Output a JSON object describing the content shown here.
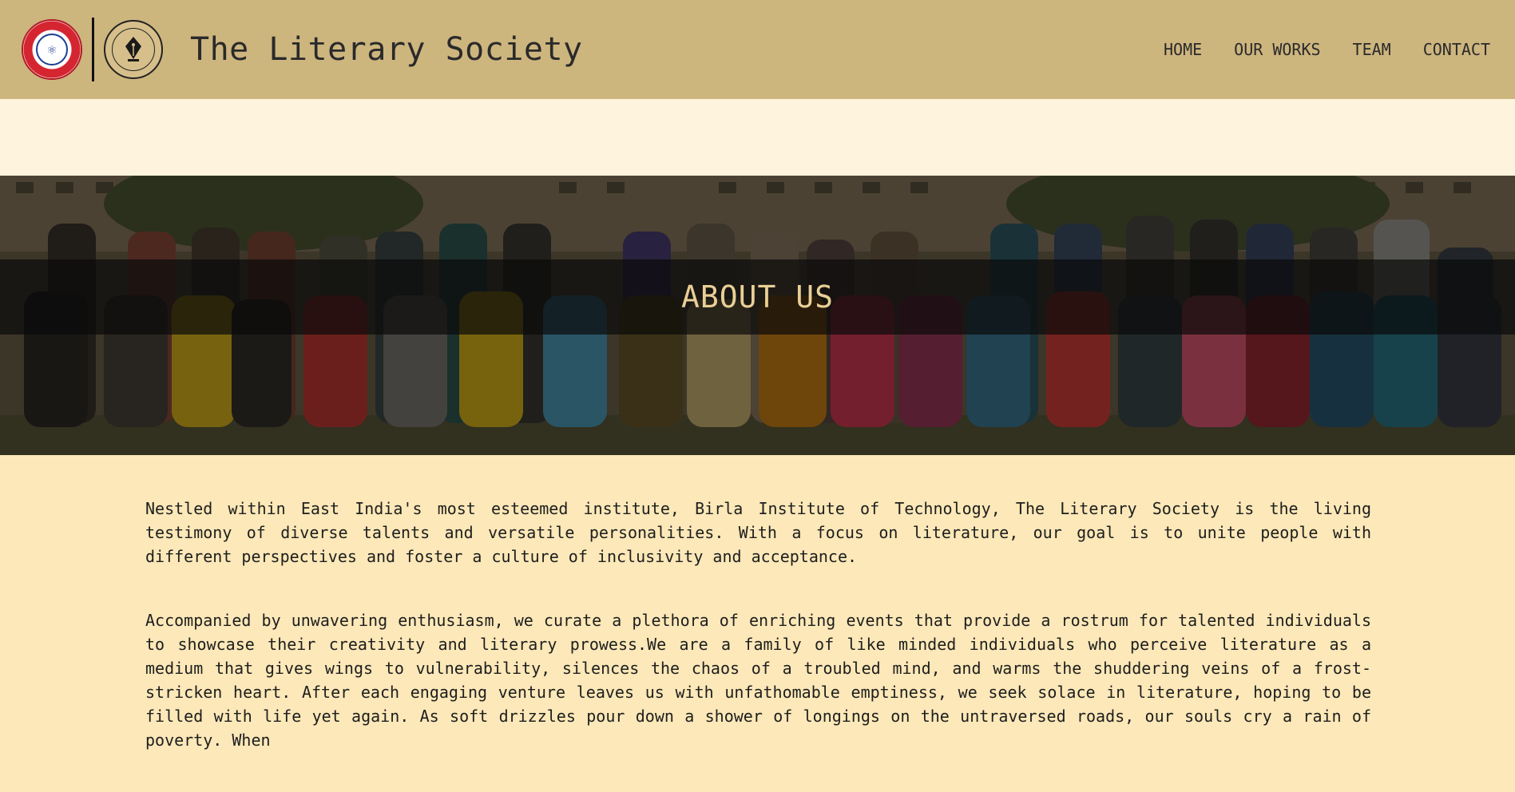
{
  "header": {
    "title": "The Literary Society",
    "logos": {
      "institute": "bit-mesra-emblem-icon",
      "society": "literary-society-emblem-icon"
    },
    "nav": [
      {
        "label": "HOME"
      },
      {
        "label": "OUR WORKS"
      },
      {
        "label": "TEAM"
      },
      {
        "label": "CONTACT"
      }
    ]
  },
  "hero": {
    "title": "ABOUT US"
  },
  "content": {
    "paragraphs": [
      "Nestled within East India's most esteemed institute, Birla Institute of Technology, The Literary Society is the living testimony of diverse talents and versatile personalities. With a focus on literature, our goal is to unite people with different perspectives and foster a culture of inclusivity and acceptance.",
      "Accompanied by unwavering enthusiasm, we curate a plethora of enriching events that provide a rostrum for talented individuals to showcase their creativity and literary prowess.We are a family of like minded individuals who perceive literature as a medium that gives wings to vulnerability, silences the chaos of a troubled mind, and warms the shuddering veins of a frost-stricken heart. After each engaging venture leaves us with unfathomable emptiness, we seek solace in literature, hoping to be filled with life yet again. As soft drizzles pour down a shower of longings on the untraversed roads, our souls cry a rain of poverty. When"
    ]
  },
  "colors": {
    "header_bg": "#cdb57e",
    "band_bg": "#fef3dc",
    "page_bg": "#fce8b8",
    "hero_title": "#e9cf95"
  }
}
